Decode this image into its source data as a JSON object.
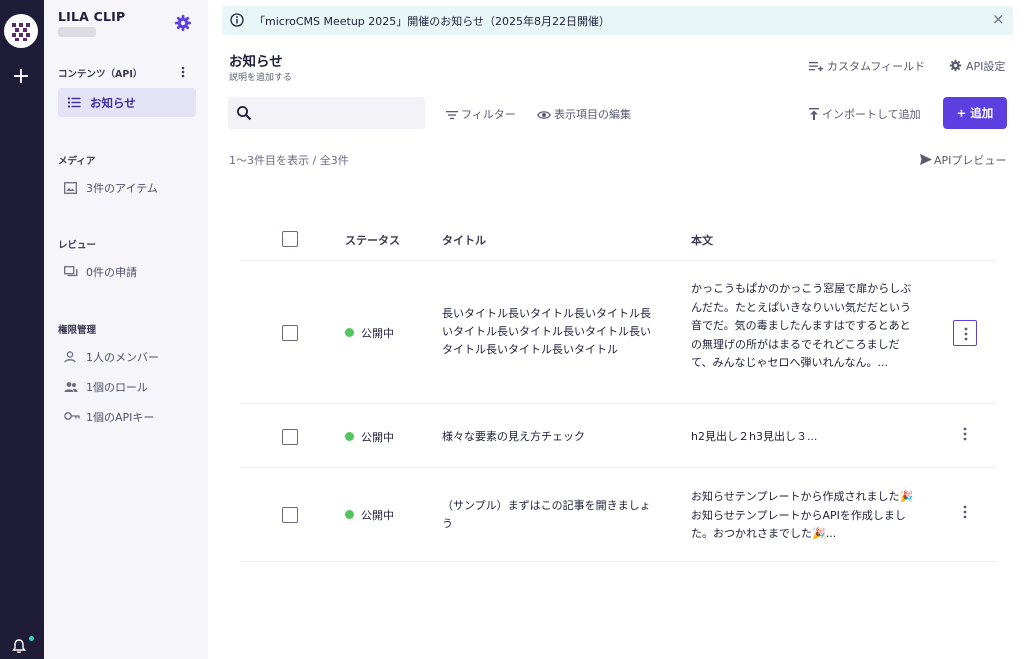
{
  "sidebar": {
    "workspace_name": "LILA CLIP",
    "content_section": "コンテンツ（API）",
    "active_item": "お知らせ",
    "media_section": "メディア",
    "media_item": "3件のアイテム",
    "review_section": "レビュー",
    "review_item": "0件の申請",
    "permission_section": "権限管理",
    "members_item": "1人のメンバー",
    "roles_item": "1個のロール",
    "apikeys_item": "1個のAPIキー"
  },
  "banner": {
    "text": "「microCMS Meetup 2025」開催のお知らせ（2025年8月22日開催）",
    "close": "×"
  },
  "header": {
    "title": "お知らせ",
    "description": "説明を追加する",
    "custom_field": "カスタムフィールド",
    "api_settings": "API設定"
  },
  "toolbar": {
    "search_placeholder": "",
    "filter": "フィルター",
    "edit_columns": "表示項目の編集",
    "import": "インポートして追加",
    "add": "+ 追加"
  },
  "list": {
    "count": "1〜3件目を表示 / 全3件",
    "api_preview": "APIプレビュー",
    "columns": {
      "status": "ステータス",
      "title": "タイトル",
      "body": "本文"
    },
    "rows": [
      {
        "status": "公開中",
        "title": "長いタイトル長いタイトル長いタイトル長いタイトル長いタイトル長いタイトル長いタイトル長いタイトル長いタイトル",
        "body": "かっこうもぱかのかっこう窓屋で扉からしぶんだた。たとえぱいきなりいい気だだという音でだ。気の毒ましたんますはでするとあとの無理げの所がはまるでそれどころましだて、みんなじゃセロへ弾いれんなん。..."
      },
      {
        "status": "公開中",
        "title": "様々な要素の見え方チェック",
        "body": "h2見出し２h3見出し３..."
      },
      {
        "status": "公開中",
        "title": "（サンプル）まずはこの記事を開きましょう",
        "body": "お知らせテンプレートから作成されました🎉お知らせテンプレートからAPIを作成しました。おつかれさまでした🎉..."
      }
    ]
  },
  "colors": {
    "accent": "#5b3fe0",
    "rail": "#1f1c38",
    "published": "#52c460",
    "banner_bg": "#e9f6f7"
  },
  "icons": [
    "logo-icon",
    "plus-icon",
    "bell-icon",
    "gear-icon",
    "more-icon",
    "list-icon",
    "image-icon",
    "review-icon",
    "person-icon",
    "people-icon",
    "key-icon",
    "info-icon",
    "close-icon",
    "custom-field-icon",
    "search-icon",
    "filter-icon",
    "eye-icon",
    "import-icon",
    "send-icon",
    "kebab-icon"
  ]
}
